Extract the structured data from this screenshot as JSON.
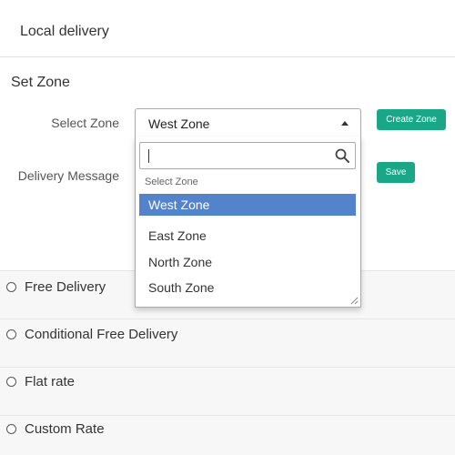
{
  "header": {
    "title": "Local delivery"
  },
  "section": {
    "title": "Set Zone"
  },
  "form": {
    "zone_label": "Select Zone",
    "message_label": "Delivery Message",
    "create_zone_label": "Create Zone",
    "save_label": "Save"
  },
  "select": {
    "value": "West Zone",
    "search_value": "",
    "group_label": "Select Zone",
    "options": [
      "West Zone",
      "East Zone",
      "North Zone",
      "South Zone"
    ],
    "selected_option": "West Zone"
  },
  "delivery_options": [
    {
      "label": "Free Delivery"
    },
    {
      "label": "Conditional Free Delivery"
    },
    {
      "label": "Flat rate"
    },
    {
      "label": "Custom Rate"
    }
  ],
  "colors": {
    "accent_green": "#1aa787",
    "selected_blue": "#5483cc"
  }
}
